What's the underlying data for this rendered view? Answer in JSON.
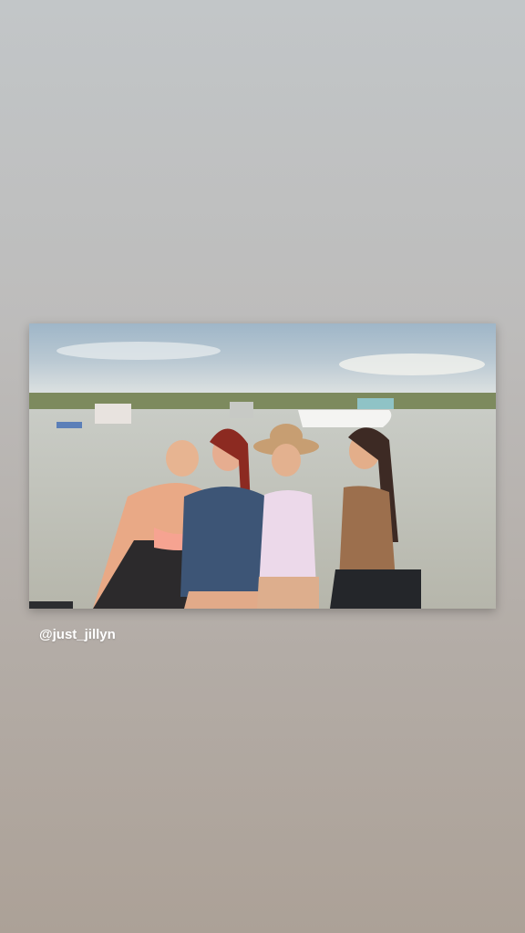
{
  "story": {
    "mention": "@just_jillyn",
    "photo_icon": "group-photo-image",
    "colors": {
      "background_top": "#c2c6c8",
      "background_bottom": "#aca197",
      "mention_text": "#ffffff"
    }
  }
}
